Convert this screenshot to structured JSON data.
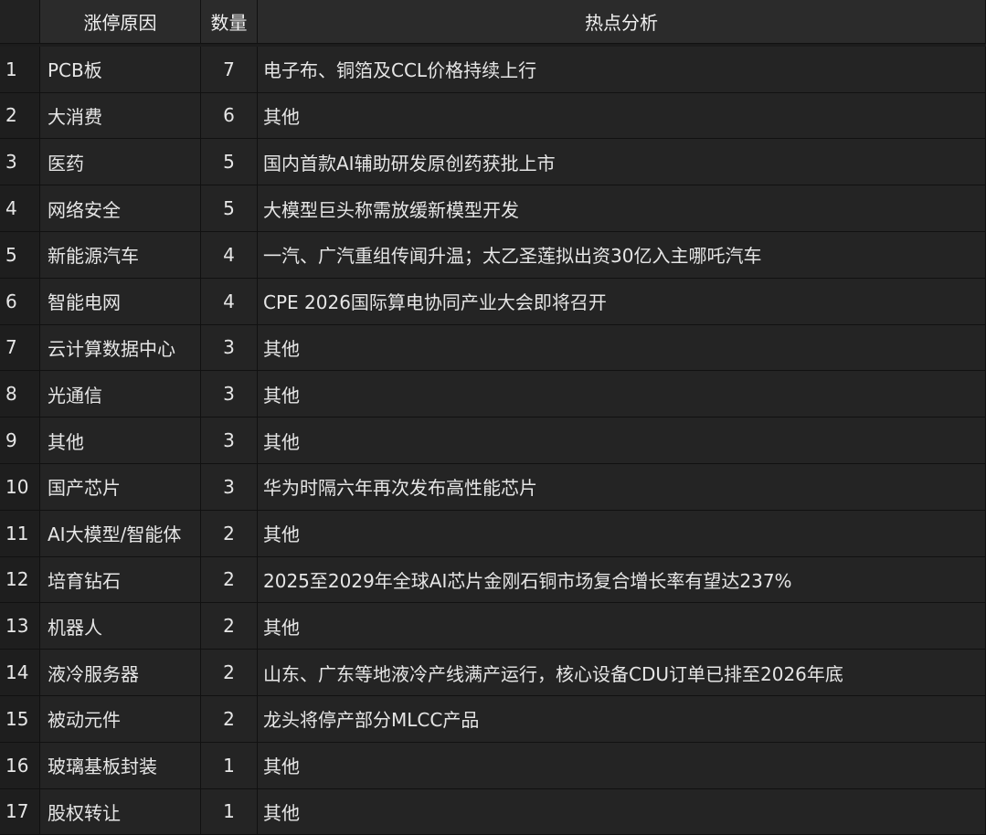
{
  "table": {
    "headers": {
      "index": "",
      "reason": "涨停原因",
      "count": "数量",
      "analysis": "热点分析"
    },
    "rows": [
      {
        "index": "1",
        "reason": "PCB板",
        "count": "7",
        "analysis": "电子布、铜箔及CCL价格持续上行"
      },
      {
        "index": "2",
        "reason": "大消费",
        "count": "6",
        "analysis": "其他"
      },
      {
        "index": "3",
        "reason": "医药",
        "count": "5",
        "analysis": "国内首款AI辅助研发原创药获批上市"
      },
      {
        "index": "4",
        "reason": "网络安全",
        "count": "5",
        "analysis": "大模型巨头称需放缓新模型开发"
      },
      {
        "index": "5",
        "reason": "新能源汽车",
        "count": "4",
        "analysis": "一汽、广汽重组传闻升温；太乙圣莲拟出资30亿入主哪吒汽车"
      },
      {
        "index": "6",
        "reason": "智能电网",
        "count": "4",
        "analysis": "CPE 2026国际算电协同产业大会即将召开"
      },
      {
        "index": "7",
        "reason": "云计算数据中心",
        "count": "3",
        "analysis": "其他"
      },
      {
        "index": "8",
        "reason": "光通信",
        "count": "3",
        "analysis": "其他"
      },
      {
        "index": "9",
        "reason": "其他",
        "count": "3",
        "analysis": "其他"
      },
      {
        "index": "10",
        "reason": "国产芯片",
        "count": "3",
        "analysis": "华为时隔六年再次发布高性能芯片"
      },
      {
        "index": "11",
        "reason": "AI大模型/智能体",
        "count": "2",
        "analysis": "其他"
      },
      {
        "index": "12",
        "reason": "培育钻石",
        "count": "2",
        "analysis": "2025至2029年全球AI芯片金刚石铜市场复合增长率有望达237%"
      },
      {
        "index": "13",
        "reason": "机器人",
        "count": "2",
        "analysis": "其他"
      },
      {
        "index": "14",
        "reason": "液冷服务器",
        "count": "2",
        "analysis": "山东、广东等地液冷产线满产运行，核心设备CDU订单已排至2026年底"
      },
      {
        "index": "15",
        "reason": "被动元件",
        "count": "2",
        "analysis": "龙头将停产部分MLCC产品"
      },
      {
        "index": "16",
        "reason": "玻璃基板封装",
        "count": "1",
        "analysis": "其他"
      },
      {
        "index": "17",
        "reason": "股权转让",
        "count": "1",
        "analysis": "其他"
      }
    ]
  }
}
